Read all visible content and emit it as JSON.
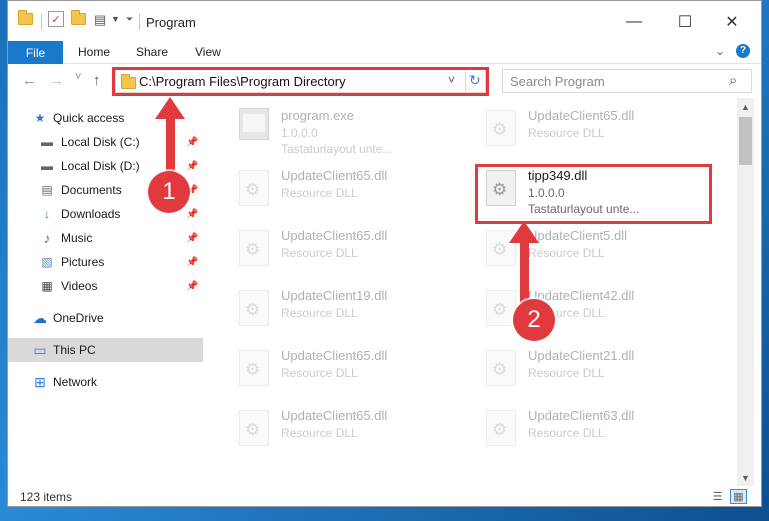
{
  "window": {
    "title": "Program",
    "controls": {
      "minimize": "—",
      "maximize": "☐",
      "close": "✕"
    }
  },
  "ribbon": {
    "tabs": [
      {
        "label": "File",
        "active": true
      },
      {
        "label": "Home"
      },
      {
        "label": "Share"
      },
      {
        "label": "View"
      }
    ],
    "expand_icon": "chevron-down-icon",
    "help_icon": "?"
  },
  "address": {
    "back": "←",
    "forward": "→",
    "recent": "˅",
    "up": "↑",
    "path": "C:\\Program Files\\Program Directory",
    "dropdown": "˅",
    "refresh": "↻",
    "search_placeholder": "Search Program",
    "search_icon": "⌕"
  },
  "sidebar": {
    "items": [
      {
        "label": "Quick access",
        "icon": "★",
        "pinned": false
      },
      {
        "label": "Local Disk (C:)",
        "icon": "▬",
        "pinned": true
      },
      {
        "label": "Local Disk (D:)",
        "icon": "▬",
        "pinned": true
      },
      {
        "label": "Documents",
        "icon": "▤",
        "pinned": true
      },
      {
        "label": "Downloads",
        "icon": "↓",
        "pinned": true
      },
      {
        "label": "Music",
        "icon": "♪",
        "pinned": true
      },
      {
        "label": "Pictures",
        "icon": "▧",
        "pinned": true
      },
      {
        "label": "Videos",
        "icon": "▦",
        "pinned": true
      },
      {
        "label": "OneDrive",
        "icon": "☁",
        "pinned": false
      },
      {
        "label": "This PC",
        "icon": "▭",
        "pinned": false,
        "selected": true
      },
      {
        "label": "Network",
        "icon": "⊞",
        "pinned": false
      }
    ],
    "pin_glyph": "📌"
  },
  "files": [
    {
      "name": "program.exe",
      "line2": "1.0.0.0",
      "line3": "Tastaturlayout unte...",
      "type": "exe",
      "faded": true
    },
    {
      "name": "UpdateClient65.dll",
      "line2": "Resource DLL",
      "faded": true
    },
    {
      "name": "UpdateClient65.dll",
      "line2": "Resource DLL",
      "faded": true
    },
    {
      "name": "tipp349.dll",
      "line2": "1.0.0.0",
      "line3": "Tastaturlayout unte...",
      "faded": false
    },
    {
      "name": "UpdateClient65.dll",
      "line2": "Resource DLL",
      "faded": true
    },
    {
      "name": "UpdateClient5.dll",
      "line2": "Resource DLL",
      "faded": true
    },
    {
      "name": "UpdateClient19.dll",
      "line2": "Resource DLL",
      "faded": true
    },
    {
      "name": "UpdateClient42.dll",
      "line2": "Resource DLL",
      "faded": true
    },
    {
      "name": "UpdateClient65.dll",
      "line2": "Resource DLL",
      "faded": true
    },
    {
      "name": "UpdateClient21.dll",
      "line2": "Resource DLL",
      "faded": true
    },
    {
      "name": "UpdateClient65.dll",
      "line2": "Resource DLL",
      "faded": true
    },
    {
      "name": "UpdateClient63.dll",
      "line2": "Resource DLL",
      "faded": true
    }
  ],
  "status": {
    "item_count": "123 items"
  },
  "annotations": {
    "step1": "1",
    "step2": "2"
  },
  "colors": {
    "accent": "#1979ca",
    "highlight": "#e0393e"
  }
}
